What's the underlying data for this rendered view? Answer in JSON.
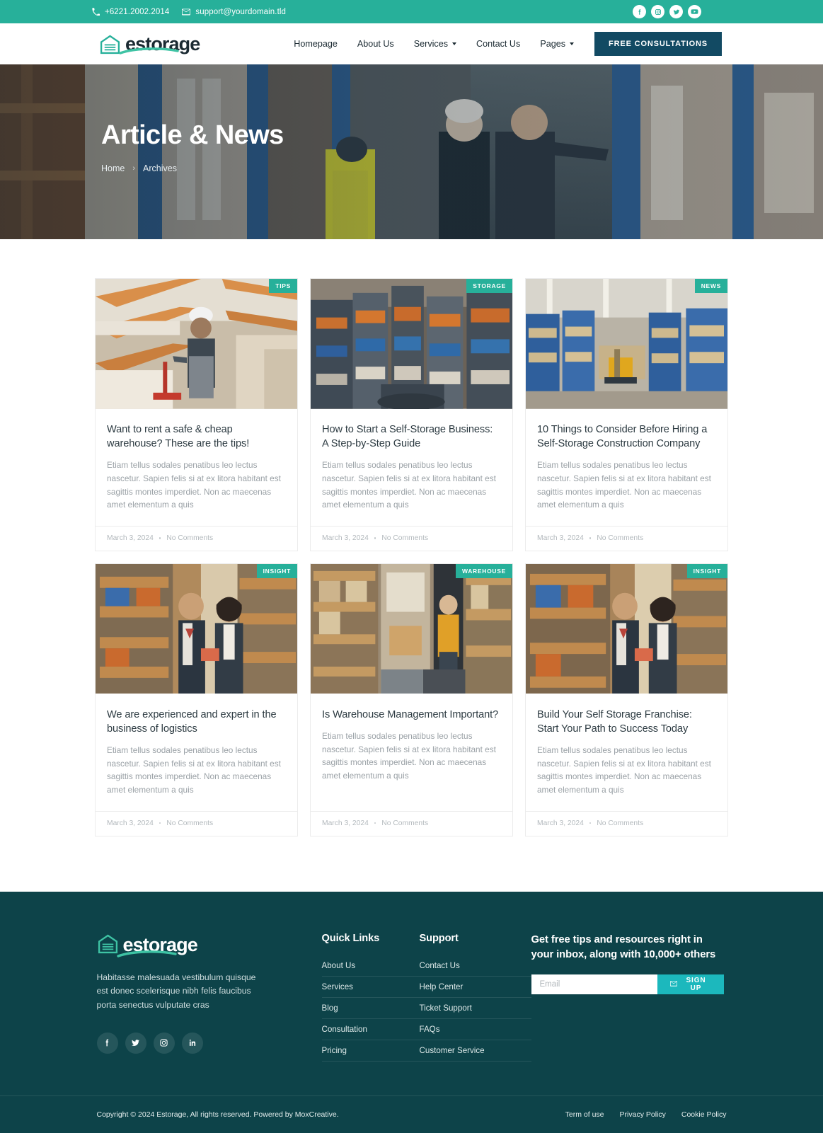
{
  "topbar": {
    "phone": "+6221.2002.2014",
    "email": "support@yourdomain.tld",
    "phone_icon": "phone-icon",
    "email_icon": "envelope-icon",
    "socials": [
      "facebook-icon",
      "instagram-icon",
      "twitter-icon",
      "youtube-icon"
    ],
    "bg_color": "#27b09a"
  },
  "header": {
    "brand": "estorage",
    "nav": [
      {
        "label": "Homepage",
        "caret": false
      },
      {
        "label": "About Us",
        "caret": false
      },
      {
        "label": "Services",
        "caret": true
      },
      {
        "label": "Contact Us",
        "caret": false
      },
      {
        "label": "Pages",
        "caret": true
      }
    ],
    "cta_label": "FREE CONSULTATIONS",
    "cta_color": "#124a63"
  },
  "hero": {
    "title": "Article & News",
    "breadcrumb": [
      "Home",
      "Archives"
    ],
    "separator": "›"
  },
  "posts": [
    {
      "badge": "TIPS",
      "title": "Want to rent a safe & cheap warehouse? These are the tips!",
      "excerpt": "Etiam tellus sodales penatibus leo lectus nascetur. Sapien felis si at ex litora habitant est sagittis montes imperdiet. Non ac maecenas amet elementum a quis",
      "date": "March 3, 2024",
      "comments": "No Comments"
    },
    {
      "badge": "STORAGE",
      "title": "How to Start a Self-Storage Business: A Step-by-Step Guide",
      "excerpt": "Etiam tellus sodales penatibus leo lectus nascetur. Sapien felis si at ex litora habitant est sagittis montes imperdiet. Non ac maecenas amet elementum a quis",
      "date": "March 3, 2024",
      "comments": "No Comments"
    },
    {
      "badge": "NEWS",
      "title": "10 Things to Consider Before Hiring a Self-Storage Construction Company",
      "excerpt": "Etiam tellus sodales penatibus leo lectus nascetur. Sapien felis si at ex litora habitant est sagittis montes imperdiet. Non ac maecenas amet elementum a quis",
      "date": "March 3, 2024",
      "comments": "No Comments"
    },
    {
      "badge": "INSIGHT",
      "title": "We are experienced and expert in the business of logistics",
      "excerpt": "Etiam tellus sodales penatibus leo lectus nascetur. Sapien felis si at ex litora habitant est sagittis montes imperdiet. Non ac maecenas amet elementum a quis",
      "date": "March 3, 2024",
      "comments": "No Comments"
    },
    {
      "badge": "WAREHOUSE",
      "title": "Is Warehouse Management Important?",
      "excerpt": "Etiam tellus sodales penatibus leo lectus nascetur. Sapien felis si at ex litora habitant est sagittis montes imperdiet. Non ac maecenas amet elementum a quis",
      "date": "March 3, 2024",
      "comments": "No Comments"
    },
    {
      "badge": "INSIGHT",
      "title": "Build Your Self Storage Franchise: Start Your Path to Success Today",
      "excerpt": "Etiam tellus sodales penatibus leo lectus nascetur. Sapien felis si at ex litora habitant est sagittis montes imperdiet. Non ac maecenas amet elementum a quis",
      "date": "March 3, 2024",
      "comments": "No Comments"
    }
  ],
  "footer": {
    "brand": "estorage",
    "description": "Habitasse malesuada vestibulum quisque est donec scelerisque nibh felis faucibus porta senectus vulputate cras",
    "socials": [
      "facebook-icon",
      "twitter-icon",
      "instagram-icon",
      "linkedin-icon"
    ],
    "quick_links": {
      "heading": "Quick Links",
      "items": [
        "About Us",
        "Services",
        "Blog",
        "Consultation",
        "Pricing"
      ]
    },
    "support": {
      "heading": "Support",
      "items": [
        "Contact Us",
        "Help Center",
        "Ticket Support",
        "FAQs",
        "Customer Service"
      ]
    },
    "newsletter": {
      "title": "Get free tips and resources right in your inbox, along with 10,000+ others",
      "placeholder": "Email",
      "value": "",
      "button_label": "SIGN UP",
      "button_icon": "envelope-icon",
      "button_color": "#1cb8bd"
    },
    "bg_color": "#0d4349"
  },
  "footer_bottom": {
    "copyright": "Copyright © 2024 Estorage, All rights reserved. Powered by MoxCreative.",
    "links": [
      "Term of use",
      "Privacy Policy",
      "Cookie Policy"
    ]
  }
}
